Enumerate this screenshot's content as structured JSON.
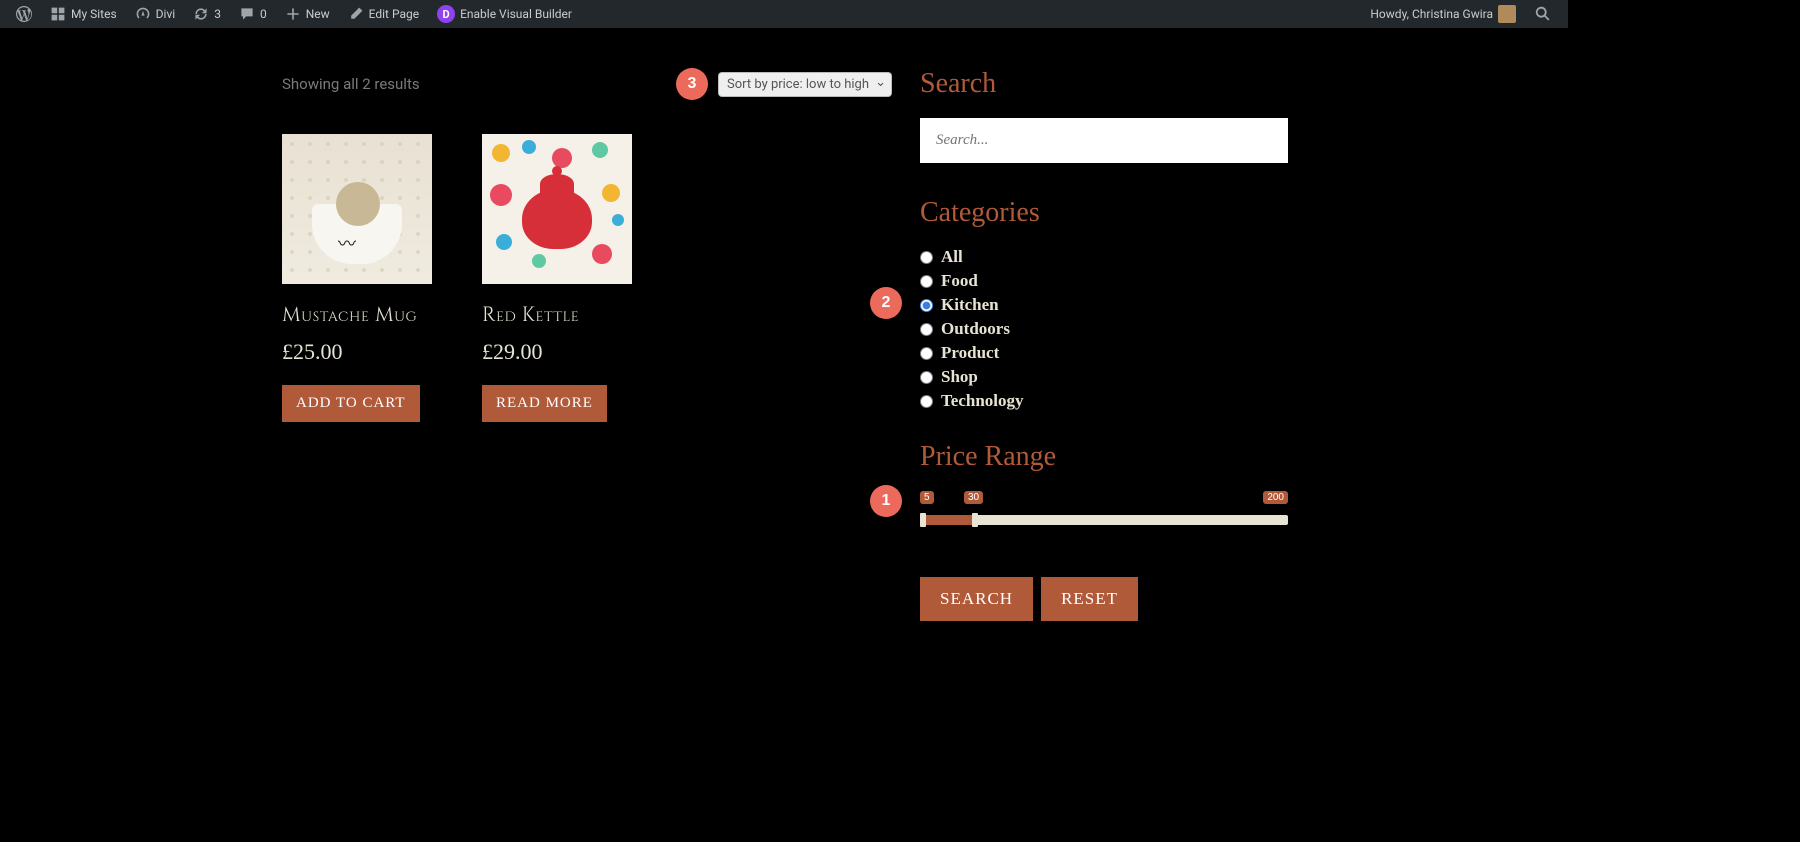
{
  "adminbar": {
    "my_sites": "My Sites",
    "site_name": "Divi",
    "updates": "3",
    "comments": "0",
    "new": "New",
    "edit_page": "Edit Page",
    "visual_builder": "Enable Visual Builder",
    "howdy": "Howdy, Christina Gwira"
  },
  "results": {
    "count_text": "Showing all 2 results",
    "sort_value": "Sort by price: low to high"
  },
  "annotations": {
    "a1": "1",
    "a2": "2",
    "a3": "3"
  },
  "products": [
    {
      "title": "Mustache Mug",
      "price": "£25.00",
      "button": "ADD TO CART"
    },
    {
      "title": "Red Kettle",
      "price": "£29.00",
      "button": "READ MORE"
    }
  ],
  "sidebar": {
    "search_heading": "Search",
    "search_placeholder": "Search...",
    "categories_heading": "Categories",
    "categories": [
      {
        "label": "All",
        "selected": false
      },
      {
        "label": "Food",
        "selected": false
      },
      {
        "label": "Kitchen",
        "selected": true
      },
      {
        "label": "Outdoors",
        "selected": false
      },
      {
        "label": "Product",
        "selected": false
      },
      {
        "label": "Shop",
        "selected": false
      },
      {
        "label": "Technology",
        "selected": false
      }
    ],
    "price_heading": "Price Range",
    "price_min": "5",
    "price_val": "30",
    "price_max": "200",
    "search_btn": "SEARCH",
    "reset_btn": "RESET"
  }
}
